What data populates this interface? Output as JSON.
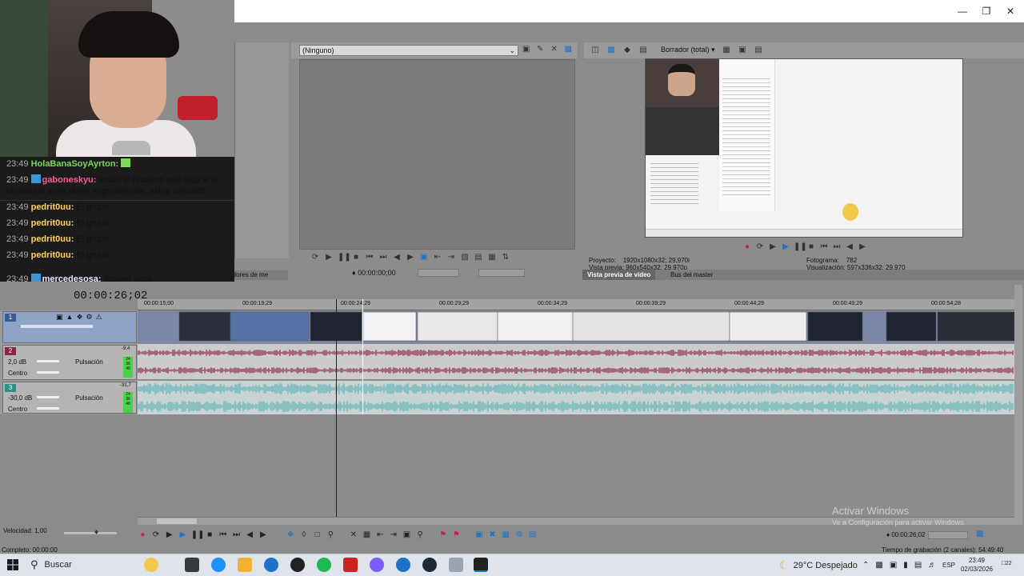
{
  "window": {
    "minimize_icon": "minimize-icon",
    "maximize_icon": "maximize-icon",
    "close_icon": "close-icon"
  },
  "overlay": {
    "chat": [
      {
        "time": "23:49",
        "user": "HolaBanaSoyAyrton:",
        "message": "",
        "color": "green"
      },
      {
        "time": "23:49",
        "user": "gaboneskyu:",
        "message": "!matu el proximo que diga si el chatterino tiene delay lo groomeare, estoy cansado",
        "color": "pink"
      },
      {
        "time": "23:49",
        "user": "pedrit0uu:",
        "message": "El grupo",
        "color": "yellow"
      },
      {
        "time": "23:49",
        "user": "pedrit0uu:",
        "message": "El grupo",
        "color": "yellow"
      },
      {
        "time": "23:49",
        "user": "pedrit0uu:",
        "message": "El grupo",
        "color": "yellow"
      },
      {
        "time": "23:49",
        "user": "pedrit0uu:",
        "message": "El grupo",
        "color": "yellow"
      },
      {
        "time": "23:49",
        "user": "mercedesosa:",
        "message": "dropeo justo",
        "color": "white"
      }
    ],
    "generator_fragment": "Generadores de me"
  },
  "trimmer": {
    "select_value": "(Ninguno)",
    "timecode": "00:00:00;00"
  },
  "preview": {
    "mode": "Borrador (total)",
    "project_label": "Proyecto:",
    "project_value": "1920x1080x32; 29,970i",
    "preview_label": "Vista previa:",
    "preview_value": "960x540x32; 29,970p",
    "frame_label": "Fotograma:",
    "frame_value": "782",
    "display_label": "Visualización:",
    "display_value": "597x336x32; 29,970",
    "tab_video": "Vista previa de vídeo",
    "tab_master": "Bus del master"
  },
  "timeline": {
    "timecode": "00:00:26;02",
    "ruler_ticks": [
      "00:00:15;00",
      "00:00:19;29",
      "00:00:24;29",
      "00:00:29;29",
      "00:00:34;29",
      "00:00:39;29",
      "00:00:44;29",
      "00:00:49;29",
      "00:00:54;28"
    ],
    "tracks": [
      {
        "number": "1",
        "type": "video"
      },
      {
        "number": "2",
        "type": "audio",
        "volume": "2,0 dB",
        "pan": "Centro",
        "mode": "Pulsación",
        "meter_values": [
          "-9,4",
          "24",
          "36",
          "48"
        ]
      },
      {
        "number": "3",
        "type": "audio",
        "volume": "-30,0 dB",
        "pan": "Centro",
        "mode": "Pulsación",
        "meter_values": [
          "-31,7",
          "24",
          "36",
          "48"
        ]
      }
    ],
    "speed": "Velocidad: 1,00",
    "complete": "Completo: 00:00:00",
    "record_time": "Tiempo de grabación (2 canales): 54:49:40",
    "cursor_time": "00:00:26;02"
  },
  "watermark": {
    "line1": "Activar Windows",
    "line2": "Ve a Configuración para activar Windows."
  },
  "taskbar": {
    "search_placeholder": "Buscar",
    "weather": "29°C  Despejado",
    "language": "ESP",
    "time": "23:49",
    "date": "02/03/2026",
    "notification_count": "22"
  },
  "colors": {
    "audio_wave_red": "#8b2642",
    "audio_wave_teal": "#5fb4b4",
    "video_track_blue": "#3b5b97",
    "meter_green": "#4bd14b"
  }
}
